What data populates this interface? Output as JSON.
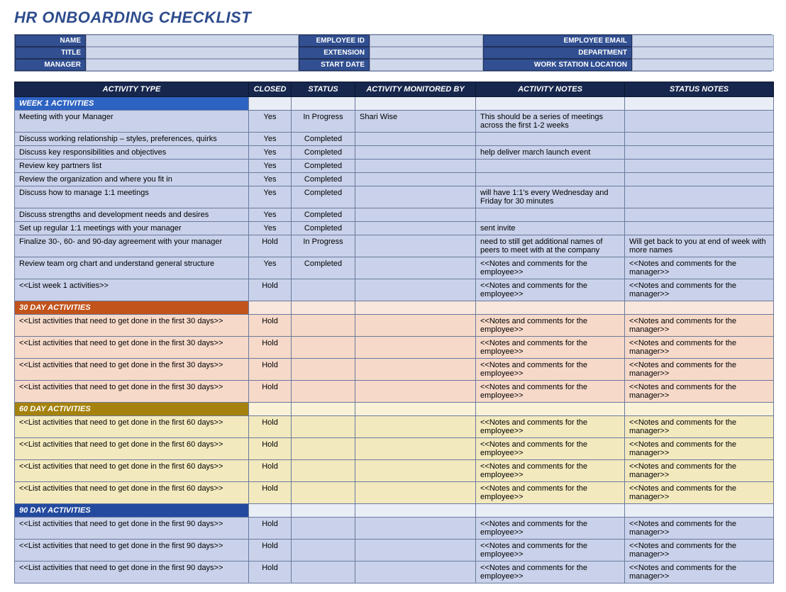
{
  "title": "HR ONBOARDING CHECKLIST",
  "info_fields": [
    {
      "label": "NAME",
      "value": ""
    },
    {
      "label": "EMPLOYEE ID",
      "value": ""
    },
    {
      "label": "EMPLOYEE EMAIL",
      "value": ""
    },
    {
      "label": "TITLE",
      "value": ""
    },
    {
      "label": "EXTENSION",
      "value": ""
    },
    {
      "label": "DEPARTMENT",
      "value": ""
    },
    {
      "label": "MANAGER",
      "value": ""
    },
    {
      "label": "START DATE",
      "value": ""
    },
    {
      "label": "WORK STATION LOCATION",
      "value": ""
    }
  ],
  "columns": [
    "ACTIVITY TYPE",
    "CLOSED",
    "STATUS",
    "ACTIVITY MONITORED BY",
    "ACTIVITY NOTES",
    "STATUS NOTES"
  ],
  "sections": [
    {
      "name": "WEEK 1 ACTIVITIES",
      "color": "blue",
      "rows": [
        {
          "activity": "Meeting with your Manager",
          "closed": "Yes",
          "status": "In Progress",
          "monitored_by": "Shari Wise",
          "activity_notes": "This should be a series of meetings across the first 1-2 weeks",
          "status_notes": ""
        },
        {
          "activity": "Discuss working relationship – styles, preferences, quirks",
          "closed": "Yes",
          "status": "Completed",
          "monitored_by": "",
          "activity_notes": "",
          "status_notes": ""
        },
        {
          "activity": "Discuss key responsibilities and objectives",
          "closed": "Yes",
          "status": "Completed",
          "monitored_by": "",
          "activity_notes": "help deliver march launch event",
          "status_notes": ""
        },
        {
          "activity": "Review key partners list",
          "closed": "Yes",
          "status": "Completed",
          "monitored_by": "",
          "activity_notes": "",
          "status_notes": ""
        },
        {
          "activity": "Review the organization and where you fit in",
          "closed": "Yes",
          "status": "Completed",
          "monitored_by": "",
          "activity_notes": "",
          "status_notes": ""
        },
        {
          "activity": "Discuss how to manage 1:1 meetings",
          "closed": "Yes",
          "status": "Completed",
          "monitored_by": "",
          "activity_notes": "will have 1:1's every Wednesday and Friday for 30 minutes",
          "status_notes": ""
        },
        {
          "activity": "Discuss strengths and development needs and desires",
          "closed": "Yes",
          "status": "Completed",
          "monitored_by": "",
          "activity_notes": "",
          "status_notes": ""
        },
        {
          "activity": "Set up regular 1:1 meetings with your manager",
          "closed": "Yes",
          "status": "Completed",
          "monitored_by": "",
          "activity_notes": "sent invite",
          "status_notes": ""
        },
        {
          "activity": "Finalize 30-, 60- and 90-day agreement with your manager",
          "closed": "Hold",
          "status": "In Progress",
          "monitored_by": "",
          "activity_notes": "need to still get additional names of peers to meet with at the company",
          "status_notes": "Will get back to you at end of week with more names"
        },
        {
          "activity": "Review team org chart and understand general structure",
          "closed": "Yes",
          "status": "Completed",
          "monitored_by": "",
          "activity_notes": "<<Notes and comments for the employee>>",
          "status_notes": "<<Notes and comments for the manager>>"
        },
        {
          "activity": "<<List week 1 activities>>",
          "closed": "Hold",
          "status": "",
          "monitored_by": "",
          "activity_notes": "<<Notes and comments for the employee>>",
          "status_notes": "<<Notes and comments for the manager>>"
        }
      ]
    },
    {
      "name": "30 DAY ACTIVITIES",
      "color": "orange",
      "rows": [
        {
          "activity": "<<List activities that need to get done in the first 30 days>>",
          "closed": "Hold",
          "status": "",
          "monitored_by": "",
          "activity_notes": "<<Notes and comments for the employee>>",
          "status_notes": "<<Notes and comments for the manager>>"
        },
        {
          "activity": "<<List activities that need to get done in the first 30 days>>",
          "closed": "Hold",
          "status": "",
          "monitored_by": "",
          "activity_notes": "<<Notes and comments for the employee>>",
          "status_notes": "<<Notes and comments for the manager>>"
        },
        {
          "activity": "<<List activities that need to get done in the first 30 days>>",
          "closed": "Hold",
          "status": "",
          "monitored_by": "",
          "activity_notes": "<<Notes and comments for the employee>>",
          "status_notes": "<<Notes and comments for the manager>>"
        },
        {
          "activity": "<<List activities that need to get done in the first 30 days>>",
          "closed": "Hold",
          "status": "",
          "monitored_by": "",
          "activity_notes": "<<Notes and comments for the employee>>",
          "status_notes": "<<Notes and comments for the manager>>"
        }
      ]
    },
    {
      "name": "60 DAY ACTIVITIES",
      "color": "olive",
      "rows": [
        {
          "activity": "<<List activities that need to get done in the first 60 days>>",
          "closed": "Hold",
          "status": "",
          "monitored_by": "",
          "activity_notes": "<<Notes and comments for the employee>>",
          "status_notes": "<<Notes and comments for the manager>>"
        },
        {
          "activity": "<<List activities that need to get done in the first 60 days>>",
          "closed": "Hold",
          "status": "",
          "monitored_by": "",
          "activity_notes": "<<Notes and comments for the employee>>",
          "status_notes": "<<Notes and comments for the manager>>"
        },
        {
          "activity": "<<List activities that need to get done in the first 60 days>>",
          "closed": "Hold",
          "status": "",
          "monitored_by": "",
          "activity_notes": "<<Notes and comments for the employee>>",
          "status_notes": "<<Notes and comments for the manager>>"
        },
        {
          "activity": "<<List activities that need to get done in the first 60 days>>",
          "closed": "Hold",
          "status": "",
          "monitored_by": "",
          "activity_notes": "<<Notes and comments for the employee>>",
          "status_notes": "<<Notes and comments for the manager>>"
        }
      ]
    },
    {
      "name": "90 DAY ACTIVITIES",
      "color": "blue2",
      "rows": [
        {
          "activity": "<<List activities that need to get done in the first 90 days>>",
          "closed": "Hold",
          "status": "",
          "monitored_by": "",
          "activity_notes": "<<Notes and comments for the employee>>",
          "status_notes": "<<Notes and comments for the manager>>"
        },
        {
          "activity": "<<List activities that need to get done in the first 90 days>>",
          "closed": "Hold",
          "status": "",
          "monitored_by": "",
          "activity_notes": "<<Notes and comments for the employee>>",
          "status_notes": "<<Notes and comments for the manager>>"
        },
        {
          "activity": "<<List activities that need to get done in the first 90 days>>",
          "closed": "Hold",
          "status": "",
          "monitored_by": "",
          "activity_notes": "<<Notes and comments for the employee>>",
          "status_notes": "<<Notes and comments for the manager>>"
        }
      ]
    }
  ]
}
